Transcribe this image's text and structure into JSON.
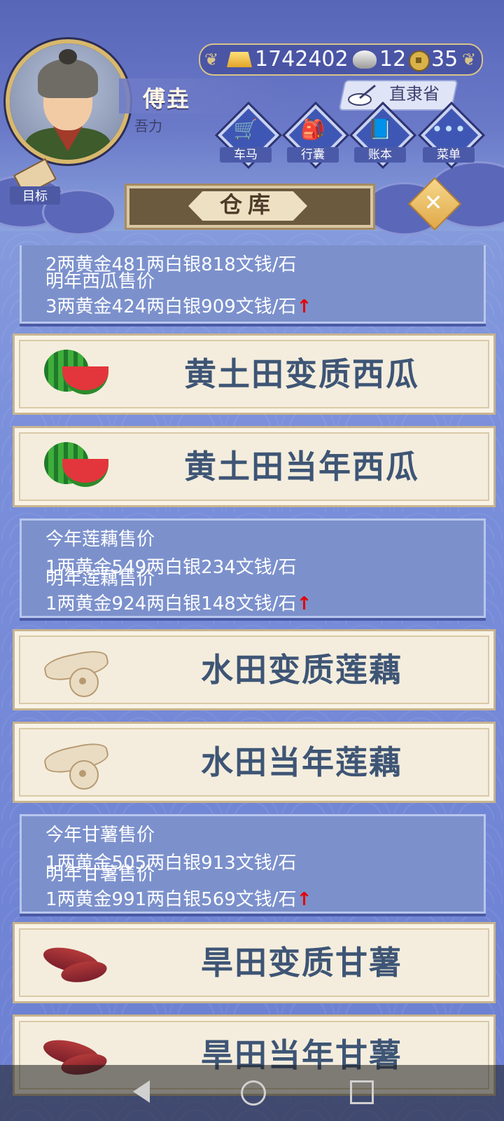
{
  "header": {
    "player_name": "傅垚",
    "player_sub": "吾力",
    "currency": {
      "gold": "1742402",
      "silver": "12",
      "coin": "35"
    },
    "location": "直隶省",
    "nav": [
      {
        "label": "车马",
        "glyph": "🛒"
      },
      {
        "label": "行囊",
        "glyph": "🎒"
      },
      {
        "label": "账本",
        "glyph": "📘"
      },
      {
        "label": "菜单",
        "glyph": "•••"
      }
    ],
    "goal_label": "目标",
    "title": "仓库",
    "close_symbol": "✕"
  },
  "list": {
    "blocks": [
      {
        "type": "price",
        "lines": [
          "2两黄金481两白银818文钱/石",
          "明年西瓜售价",
          "3两黄金424两白银909文钱/石"
        ],
        "arrow": "↑"
      },
      {
        "type": "item",
        "name": "黄土田变质西瓜",
        "icon": "watermelon-icon"
      },
      {
        "type": "item",
        "name": "黄土田当年西瓜",
        "icon": "watermelon-icon"
      },
      {
        "type": "price",
        "lines": [
          "今年莲藕售价",
          "1两黄金549两白银234文钱/石",
          "明年莲藕售价",
          "1两黄金924两白银148文钱/石"
        ],
        "arrow": "↑"
      },
      {
        "type": "item",
        "name": "水田变质莲藕",
        "icon": "lotus-root-icon"
      },
      {
        "type": "item",
        "name": "水田当年莲藕",
        "icon": "lotus-root-icon"
      },
      {
        "type": "price",
        "lines": [
          "今年甘薯售价",
          "1两黄金505两白银913文钱/石",
          "明年甘薯售价",
          "1两黄金991两白银569文钱/石"
        ],
        "arrow": "↑"
      },
      {
        "type": "item",
        "name": "旱田变质甘薯",
        "icon": "sweet-potato-icon"
      },
      {
        "type": "item",
        "name": "旱田当年甘薯",
        "icon": "sweet-potato-icon"
      }
    ]
  },
  "colors": {
    "accent": "#d8b86c",
    "price_up": "#e30000",
    "item_text": "#3e5575"
  }
}
